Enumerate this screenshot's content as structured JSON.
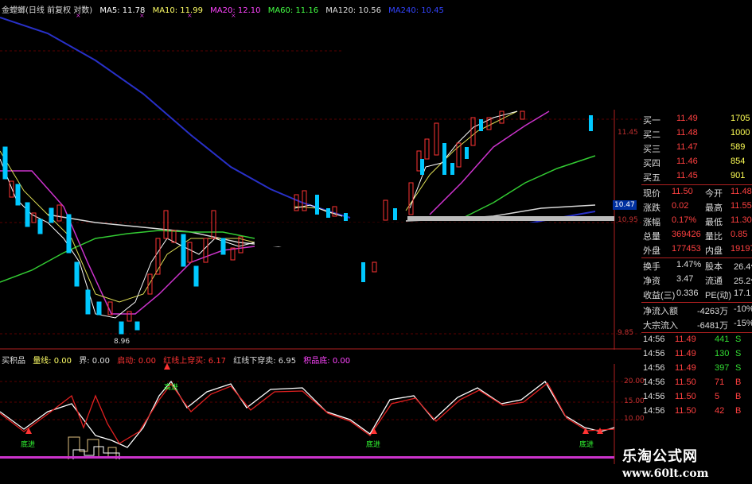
{
  "main_chart": {
    "title": "金螳螂(日线 前复权 对数)",
    "ma": [
      {
        "label": "MA5: 11.78",
        "color": "#ffffff"
      },
      {
        "label": "MA10: 11.99",
        "color": "#ffff66"
      },
      {
        "label": "MA20: 12.10",
        "color": "#ff44ff"
      },
      {
        "label": "MA60: 11.16",
        "color": "#44ff44"
      },
      {
        "label": "MA120: 10.56",
        "color": "#dddddd"
      },
      {
        "label": "MA240: 10.45",
        "color": "#3344ff"
      }
    ],
    "y_ticks": [
      "11.45",
      "10.95",
      "9.85"
    ],
    "current_price_tag": "10.47",
    "low_label": "8.96"
  },
  "indicator_panel": {
    "name": "买积品",
    "items": [
      {
        "label": "量线: 0.00",
        "color": "#ffff66"
      },
      {
        "label": "界: 0.00",
        "color": "#dddddd"
      },
      {
        "label": "启动: 0.00",
        "color": "#ff3333"
      },
      {
        "label": "红线上穿买: 6.17",
        "color": "#ff3333"
      },
      {
        "label": "红线下穿卖: 6.95",
        "color": "#dddddd"
      },
      {
        "label": "积品底: 0.00",
        "color": "#ff44ff"
      }
    ],
    "y_ticks": [
      "20.00",
      "15.00",
      "10.00"
    ],
    "markers": [
      "高进",
      "底进",
      "底进",
      "底进"
    ]
  },
  "quote_panel": {
    "bid_rows": [
      {
        "label": "买一",
        "price": "11.49",
        "vol": "1705"
      },
      {
        "label": "买二",
        "price": "11.48",
        "vol": "1000"
      },
      {
        "label": "买三",
        "price": "11.47",
        "vol": "589"
      },
      {
        "label": "买四",
        "price": "11.46",
        "vol": "854"
      },
      {
        "label": "买五",
        "price": "11.45",
        "vol": "901"
      }
    ],
    "stats": [
      {
        "l1": "现价",
        "v1": "11.50",
        "l2": "今开",
        "v2": "11.48"
      },
      {
        "l1": "涨跌",
        "v1": "0.02",
        "l2": "最高",
        "v2": "11.55"
      },
      {
        "l1": "涨幅",
        "v1": "0.17%",
        "l2": "最低",
        "v2": "11.30"
      },
      {
        "l1": "总量",
        "v1": "369426",
        "l2": "量比",
        "v2": "0.85"
      },
      {
        "l1": "外盘",
        "v1": "177453",
        "l2": "内盘",
        "v2": "191973"
      }
    ],
    "stats2": [
      {
        "l1": "换手",
        "v1": "1.47%",
        "l2": "股本",
        "v2": "26.4亿"
      },
      {
        "l1": "净资",
        "v1": "3.47",
        "l2": "流通",
        "v2": "25.2亿"
      },
      {
        "l1": "收益(三)",
        "v1": "0.336",
        "l2": "PE(动)",
        "v2": "17.1"
      }
    ],
    "flows": [
      {
        "label": "净流入额",
        "value": "-4263万",
        "pct": "-10%"
      },
      {
        "label": "大宗流入",
        "value": "-6481万",
        "pct": "-15%"
      }
    ],
    "ticks": [
      {
        "time": "14:56",
        "price": "11.49",
        "vol": "441",
        "side": "S"
      },
      {
        "time": "14:56",
        "price": "11.49",
        "vol": "130",
        "side": "S"
      },
      {
        "time": "14:56",
        "price": "11.49",
        "vol": "397",
        "side": "S"
      },
      {
        "time": "14:56",
        "price": "11.50",
        "vol": "71",
        "side": "B"
      },
      {
        "time": "14:56",
        "price": "11.50",
        "vol": "5",
        "side": "B"
      },
      {
        "time": "14:56",
        "price": "11.50",
        "vol": "42",
        "side": "B"
      }
    ]
  },
  "watermark": {
    "line1": "乐淘公式网",
    "line2": "www.60lt.com"
  }
}
